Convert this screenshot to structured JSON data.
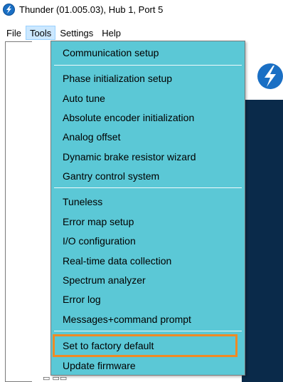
{
  "window": {
    "title": "Thunder (01.005.03), Hub 1, Port 5"
  },
  "menubar": {
    "items": [
      {
        "label": "File"
      },
      {
        "label": "Tools"
      },
      {
        "label": "Settings"
      },
      {
        "label": "Help"
      }
    ],
    "active": "Tools"
  },
  "tools_menu": {
    "groups": [
      [
        "Communication setup"
      ],
      [
        "Phase initialization setup",
        "Auto tune",
        "Absolute encoder initialization",
        "Analog offset",
        "Dynamic brake resistor wizard",
        "Gantry control system"
      ],
      [
        "Tuneless",
        "Error map setup",
        "I/O configuration",
        "Real-time data collection",
        "Spectrum analyzer",
        "Error log",
        "Messages+command prompt"
      ],
      [
        "Set to factory default",
        "Update firmware"
      ]
    ],
    "highlighted_item": "Set to factory default"
  },
  "colors": {
    "menu_bg": "#5bc8d6",
    "highlight_border": "#f08a24",
    "active_menu_bg": "#cce8ff"
  },
  "icons": {
    "app": "thunder-app-icon"
  }
}
